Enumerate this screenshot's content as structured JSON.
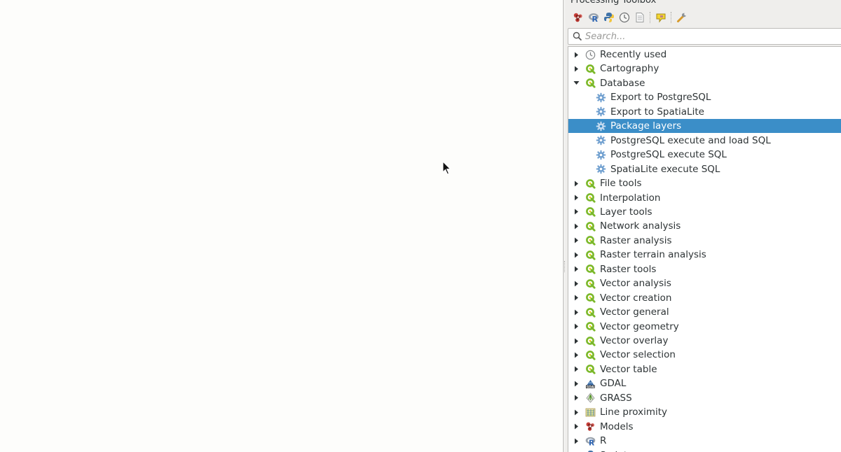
{
  "toolbox": {
    "title": "Processing Toolbox",
    "search_placeholder": "Search...",
    "toolbar": [
      {
        "name": "models-icon"
      },
      {
        "name": "r-scripts-icon"
      },
      {
        "name": "python-scripts-icon"
      },
      {
        "name": "history-icon"
      },
      {
        "name": "results-viewer-icon"
      },
      {
        "name": "edit-features-in-place-icon"
      },
      {
        "name": "options-icon"
      }
    ],
    "tree": [
      {
        "label": "Recently used",
        "icon": "clock-icon",
        "level": 0,
        "arrow": "collapsed"
      },
      {
        "label": "Cartography",
        "icon": "qgis-icon",
        "level": 0,
        "arrow": "collapsed"
      },
      {
        "label": "Database",
        "icon": "qgis-icon",
        "level": 0,
        "arrow": "expanded"
      },
      {
        "label": "Export to PostgreSQL",
        "icon": "algorithm-gear-icon",
        "level": 1
      },
      {
        "label": "Export to SpatiaLite",
        "icon": "algorithm-gear-icon",
        "level": 1
      },
      {
        "label": "Package layers",
        "icon": "algorithm-gear-icon",
        "level": 1,
        "selected": true
      },
      {
        "label": "PostgreSQL execute and load SQL",
        "icon": "algorithm-gear-icon",
        "level": 1
      },
      {
        "label": "PostgreSQL execute SQL",
        "icon": "algorithm-gear-icon",
        "level": 1
      },
      {
        "label": "SpatiaLite execute SQL",
        "icon": "algorithm-gear-icon",
        "level": 1
      },
      {
        "label": "File tools",
        "icon": "qgis-icon",
        "level": 0,
        "arrow": "collapsed"
      },
      {
        "label": "Interpolation",
        "icon": "qgis-icon",
        "level": 0,
        "arrow": "collapsed"
      },
      {
        "label": "Layer tools",
        "icon": "qgis-icon",
        "level": 0,
        "arrow": "collapsed"
      },
      {
        "label": "Network analysis",
        "icon": "qgis-icon",
        "level": 0,
        "arrow": "collapsed"
      },
      {
        "label": "Raster analysis",
        "icon": "qgis-icon",
        "level": 0,
        "arrow": "collapsed"
      },
      {
        "label": "Raster terrain analysis",
        "icon": "qgis-icon",
        "level": 0,
        "arrow": "collapsed"
      },
      {
        "label": "Raster tools",
        "icon": "qgis-icon",
        "level": 0,
        "arrow": "collapsed"
      },
      {
        "label": "Vector analysis",
        "icon": "qgis-icon",
        "level": 0,
        "arrow": "collapsed"
      },
      {
        "label": "Vector creation",
        "icon": "qgis-icon",
        "level": 0,
        "arrow": "collapsed"
      },
      {
        "label": "Vector general",
        "icon": "qgis-icon",
        "level": 0,
        "arrow": "collapsed"
      },
      {
        "label": "Vector geometry",
        "icon": "qgis-icon",
        "level": 0,
        "arrow": "collapsed"
      },
      {
        "label": "Vector overlay",
        "icon": "qgis-icon",
        "level": 0,
        "arrow": "collapsed"
      },
      {
        "label": "Vector selection",
        "icon": "qgis-icon",
        "level": 0,
        "arrow": "collapsed"
      },
      {
        "label": "Vector table",
        "icon": "qgis-icon",
        "level": 0,
        "arrow": "collapsed"
      },
      {
        "label": "GDAL",
        "icon": "gdal-icon",
        "level": 0,
        "arrow": "collapsed"
      },
      {
        "label": "GRASS",
        "icon": "grass-icon",
        "level": 0,
        "arrow": "collapsed"
      },
      {
        "label": "Line proximity",
        "icon": "line-proximity-icon",
        "level": 0,
        "arrow": "collapsed"
      },
      {
        "label": "Models",
        "icon": "models-icon",
        "level": 0,
        "arrow": "collapsed"
      },
      {
        "label": "R",
        "icon": "r-icon",
        "level": 0,
        "arrow": "collapsed"
      },
      {
        "label": "Scripts",
        "icon": "python-icon",
        "level": 0,
        "arrow": "collapsed"
      }
    ]
  },
  "colors": {
    "selection": "#3b8ec8",
    "qgis_green": "#7ab829",
    "gear_blue": "#6f9fcf"
  }
}
